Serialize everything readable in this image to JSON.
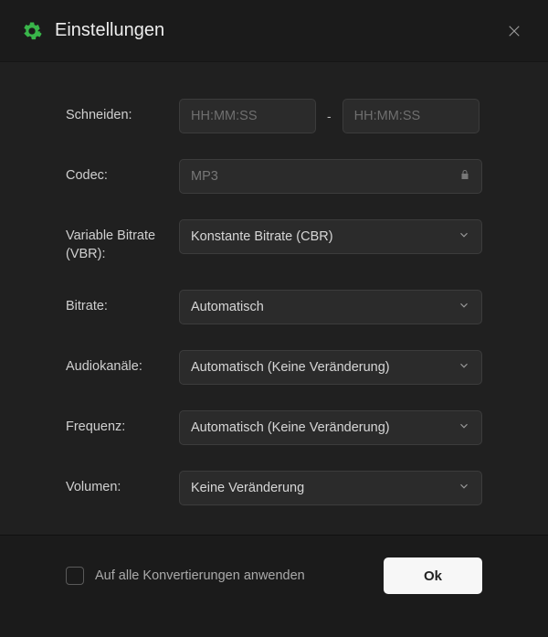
{
  "header": {
    "title": "Einstellungen"
  },
  "fields": {
    "trim": {
      "label": "Schneiden:",
      "placeholder_from": "HH:MM:SS",
      "placeholder_to": "HH:MM:SS",
      "separator": "-"
    },
    "codec": {
      "label": "Codec:",
      "value": "MP3"
    },
    "vbr": {
      "label": "Variable Bitrate (VBR):",
      "value": "Konstante Bitrate (CBR)"
    },
    "bitrate": {
      "label": "Bitrate:",
      "value": "Automatisch"
    },
    "channels": {
      "label": "Audiokanäle:",
      "value": "Automatisch (Keine Veränderung)"
    },
    "frequency": {
      "label": "Frequenz:",
      "value": "Automatisch (Keine Veränderung)"
    },
    "volume": {
      "label": "Volumen:",
      "value": "Keine Veränderung"
    }
  },
  "footer": {
    "apply_all": "Auf alle Konvertierungen anwenden",
    "ok": "Ok"
  }
}
